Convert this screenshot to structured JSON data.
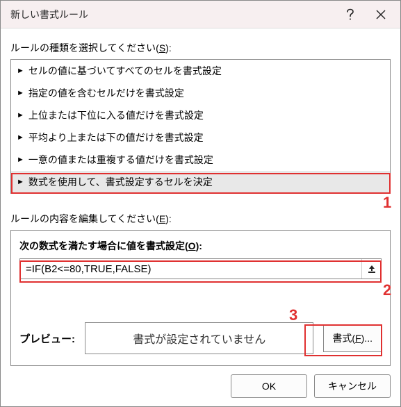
{
  "title": "新しい書式ルール",
  "section_select_label_pre": "ルールの種類を選択してください(",
  "section_select_label_u": "S",
  "section_select_label_post": "):",
  "rules": [
    "セルの値に基づいてすべてのセルを書式設定",
    "指定の値を含むセルだけを書式設定",
    "上位または下位に入る値だけを書式設定",
    "平均より上または下の値だけを書式設定",
    "一意の値または重複する値だけを書式設定",
    "数式を使用して、書式設定するセルを決定"
  ],
  "section_edit_label_pre": "ルールの内容を編集してください(",
  "section_edit_label_u": "E",
  "section_edit_label_post": "):",
  "formula_label_pre": "次の数式を満たす場合に値を書式設定(",
  "formula_label_u": "O",
  "formula_label_post": "):",
  "formula_value": "=IF(B2<=80,TRUE,FALSE)",
  "preview_label": "プレビュー:",
  "preview_text": "書式が設定されていません",
  "format_btn_pre": "書式(",
  "format_btn_u": "F",
  "format_btn_post": ")...",
  "ok_label": "OK",
  "cancel_label": "キャンセル",
  "annot": {
    "n1": "1",
    "n2": "2",
    "n3": "3"
  }
}
